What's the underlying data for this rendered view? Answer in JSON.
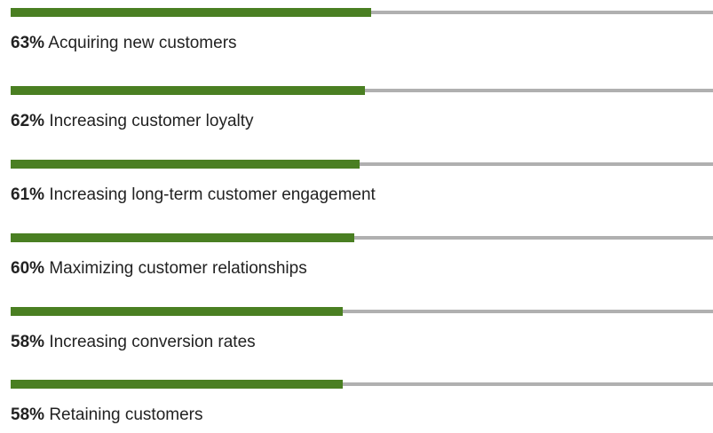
{
  "chart_data": {
    "type": "bar",
    "orientation": "horizontal",
    "categories": [
      "Acquiring new customers",
      "Increasing customer loyalty",
      "Increasing long-term customer engagement",
      "Maximizing customer relationships",
      "Increasing conversion rates",
      "Retaining customers"
    ],
    "values": [
      63,
      62,
      61,
      60,
      58,
      58
    ],
    "value_labels": [
      "63%",
      "62%",
      "61%",
      "60%",
      "58%",
      "58%"
    ],
    "unit": "%",
    "title": "",
    "xlabel": "",
    "ylabel": "",
    "xlim": [
      0,
      100
    ],
    "grid": false,
    "legend": "none",
    "colors": {
      "bar": "#4a7f22",
      "track": "#b0b0b0",
      "text": "#222222"
    }
  }
}
